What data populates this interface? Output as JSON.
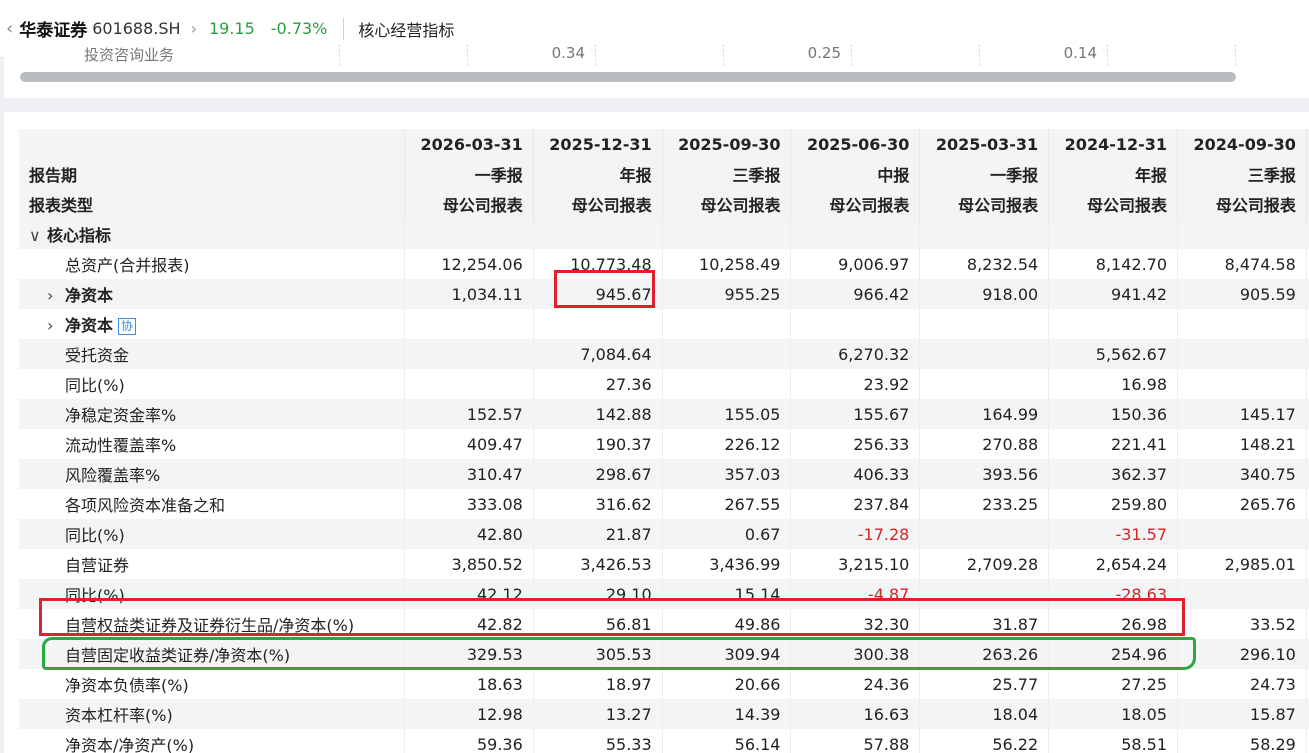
{
  "header": {
    "stock_name": "华泰证券",
    "stock_code": "601688.SH",
    "price": "19.15",
    "change": "-0.73%",
    "page_title": "核心经营指标"
  },
  "previous_row": {
    "label": "投资咨询业务",
    "values": [
      "0.34",
      "0.25",
      "0.14"
    ]
  },
  "table": {
    "header_rows": [
      {
        "label": "",
        "cells": [
          "2026-03-31",
          "2025-12-31",
          "2025-09-30",
          "2025-06-30",
          "2025-03-31",
          "2024-12-31",
          "2024-09-30"
        ]
      },
      {
        "label": "报告期",
        "cells": [
          "一季报",
          "年报",
          "三季报",
          "中报",
          "一季报",
          "年报",
          "三季报"
        ]
      },
      {
        "label": "报表类型",
        "cells": [
          "母公司报表",
          "母公司报表",
          "母公司报表",
          "母公司报表",
          "母公司报表",
          "母公司报表",
          "母公司报表"
        ]
      }
    ],
    "rows": [
      {
        "label": "核心指标",
        "kind": "section",
        "cells": [
          "",
          "",
          "",
          "",
          "",
          "",
          ""
        ]
      },
      {
        "label": "总资产(合并报表)",
        "kind": "plain",
        "cells": [
          "12,254.06",
          "10,773.48",
          "10,258.49",
          "9,006.97",
          "8,232.54",
          "8,142.70",
          "8,474.58"
        ]
      },
      {
        "label": "净资本",
        "kind": "expand",
        "cells": [
          "1,034.11",
          "945.67",
          "955.25",
          "966.42",
          "918.00",
          "941.42",
          "905.59"
        ]
      },
      {
        "label": "净资本",
        "kind": "expand-badge",
        "badge": "协",
        "cells": [
          "",
          "",
          "",
          "",
          "",
          "",
          ""
        ]
      },
      {
        "label": "受托资金",
        "kind": "plain",
        "cells": [
          "",
          "7,084.64",
          "",
          "6,270.32",
          "",
          "5,562.67",
          ""
        ]
      },
      {
        "label": "同比(%)",
        "kind": "plain",
        "cells": [
          "",
          "27.36",
          "",
          "23.92",
          "",
          "16.98",
          ""
        ]
      },
      {
        "label": "净稳定资金率%",
        "kind": "plain",
        "cells": [
          "152.57",
          "142.88",
          "155.05",
          "155.67",
          "164.99",
          "150.36",
          "145.17"
        ]
      },
      {
        "label": "流动性覆盖率%",
        "kind": "plain",
        "cells": [
          "409.47",
          "190.37",
          "226.12",
          "256.33",
          "270.88",
          "221.41",
          "148.21"
        ]
      },
      {
        "label": "风险覆盖率%",
        "kind": "plain",
        "cells": [
          "310.47",
          "298.67",
          "357.03",
          "406.33",
          "393.56",
          "362.37",
          "340.75"
        ]
      },
      {
        "label": "各项风险资本准备之和",
        "kind": "plain",
        "cells": [
          "333.08",
          "316.62",
          "267.55",
          "237.84",
          "233.25",
          "259.80",
          "265.76"
        ]
      },
      {
        "label": "同比(%)",
        "kind": "plain",
        "cells": [
          "42.80",
          "21.87",
          "0.67",
          "-17.28",
          "",
          "-31.57",
          ""
        ]
      },
      {
        "label": "自营证券",
        "kind": "plain",
        "cells": [
          "3,850.52",
          "3,426.53",
          "3,436.99",
          "3,215.10",
          "2,709.28",
          "2,654.24",
          "2,985.01"
        ]
      },
      {
        "label": "同比(%)",
        "kind": "plain",
        "cells": [
          "42.12",
          "29.10",
          "15.14",
          "-4.87",
          "",
          "-28.63",
          ""
        ]
      },
      {
        "label": "自营权益类证券及证券衍生品/净资本(%)",
        "kind": "plain",
        "cells": [
          "42.82",
          "56.81",
          "49.86",
          "32.30",
          "31.87",
          "26.98",
          "33.52"
        ]
      },
      {
        "label": "自营固定收益类证券/净资本(%)",
        "kind": "plain",
        "cells": [
          "329.53",
          "305.53",
          "309.94",
          "300.38",
          "263.26",
          "254.96",
          "296.10"
        ]
      },
      {
        "label": "净资本负债率(%)",
        "kind": "plain",
        "cells": [
          "18.63",
          "18.97",
          "20.66",
          "24.36",
          "25.77",
          "27.25",
          "24.73"
        ]
      },
      {
        "label": "资本杠杆率(%)",
        "kind": "plain",
        "cells": [
          "12.98",
          "13.27",
          "14.39",
          "16.63",
          "18.04",
          "18.05",
          "15.87"
        ]
      },
      {
        "label": "净资本/净资产(%)",
        "kind": "plain",
        "cells": [
          "59.36",
          "55.33",
          "56.14",
          "57.88",
          "56.22",
          "58.51",
          "58.29"
        ]
      }
    ]
  },
  "colors": {
    "positive_quote": "#2a9d3c",
    "negative_value": "#d42424",
    "highlight_red": "#e0202a",
    "highlight_green": "#29a844"
  }
}
